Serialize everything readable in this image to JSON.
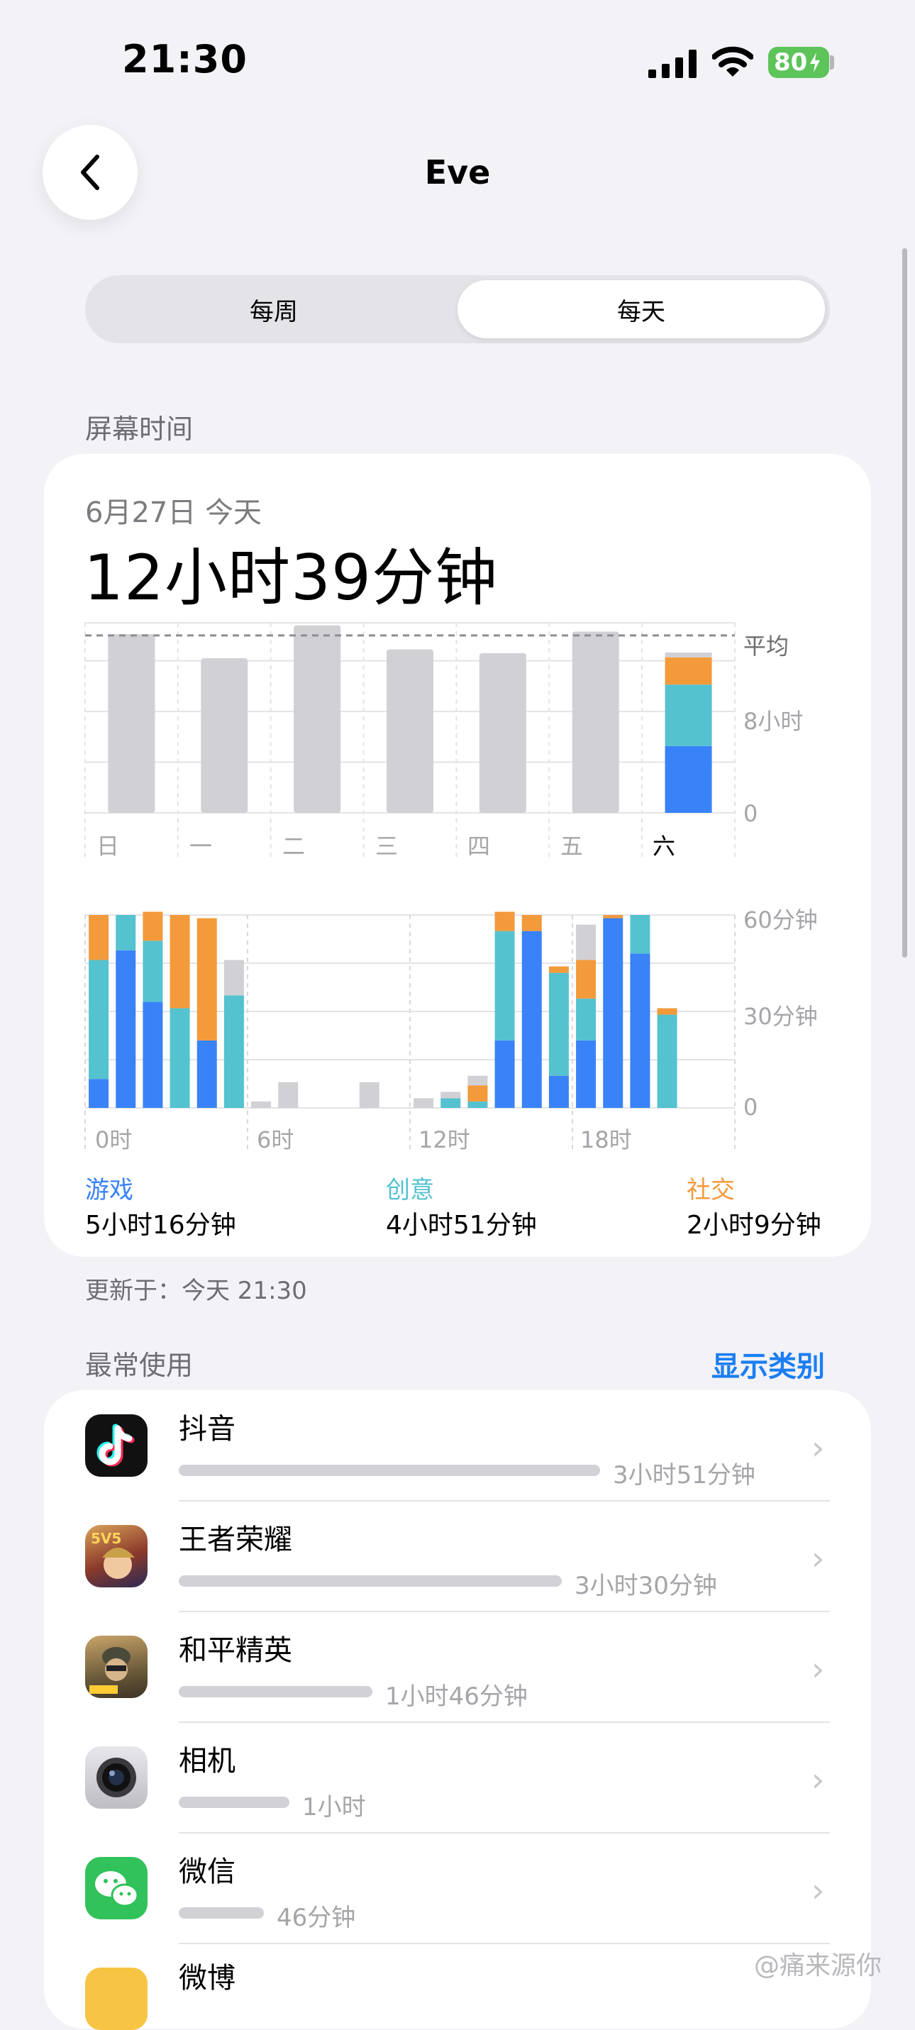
{
  "status": {
    "time": "21:30",
    "battery": "80"
  },
  "nav": {
    "title": "Eve"
  },
  "segmented": {
    "weekly": "每周",
    "daily": "每天",
    "selected": "daily"
  },
  "screen_time": {
    "section_title": "屏幕时间",
    "date": "6月27日 今天",
    "total": "12小时39分钟",
    "updated": "更新于：今天 21:30"
  },
  "colors": {
    "games": "#3a82f7",
    "creative": "#54c2cf",
    "social": "#f39a3b",
    "other": "#d0d0d5",
    "accent": "#1a7ef2"
  },
  "chart_data": [
    {
      "type": "bar",
      "categories": [
        "日",
        "一",
        "二",
        "三",
        "四",
        "五",
        "六"
      ],
      "ylabels": [
        "平均",
        "8小时",
        "0"
      ],
      "series": [
        {
          "values": [
            14.1,
            12.2,
            14.8,
            12.9,
            12.6,
            14.3,
            12.65
          ]
        }
      ],
      "stacks_today": {
        "games": 5.27,
        "creative": 4.85,
        "social": 2.15,
        "other": 0.38
      },
      "average": 14.0,
      "ylim": [
        0,
        15
      ]
    },
    {
      "type": "bar",
      "stacked": true,
      "xlabels": [
        "0时",
        "6时",
        "12时",
        "18时"
      ],
      "ylabels": [
        "60分钟",
        "30分钟",
        "0"
      ],
      "ylim": [
        0,
        60
      ],
      "hours": [
        0,
        1,
        2,
        3,
        4,
        5,
        6,
        7,
        8,
        9,
        10,
        11,
        12,
        13,
        14,
        15,
        16,
        17,
        18,
        19,
        20,
        21,
        22,
        23
      ],
      "series": [
        {
          "name": "游戏",
          "values": [
            9,
            49,
            33,
            0,
            21,
            0,
            0,
            0,
            0,
            0,
            0,
            0,
            0,
            0,
            0,
            21,
            55,
            10,
            21,
            59,
            48,
            0,
            0,
            0
          ]
        },
        {
          "name": "创意",
          "values": [
            37,
            11,
            19,
            31,
            0,
            35,
            0,
            0,
            0,
            0,
            0,
            0,
            0,
            3,
            2,
            34,
            0,
            32,
            13,
            0,
            12,
            29,
            0,
            0
          ]
        },
        {
          "name": "社交",
          "values": [
            14,
            0,
            9,
            29,
            38,
            0,
            0,
            0,
            0,
            0,
            0,
            0,
            0,
            0,
            5,
            6,
            5,
            2,
            12,
            1,
            0,
            2,
            0,
            0
          ]
        },
        {
          "name": "其他",
          "values": [
            0,
            0,
            0,
            0,
            0,
            11,
            2,
            8,
            0,
            0,
            8,
            0,
            3,
            2,
            3,
            0,
            0,
            0,
            11,
            0,
            0,
            0,
            0,
            0
          ]
        }
      ]
    }
  ],
  "legend": [
    {
      "label": "游戏",
      "value": "5小时16分钟",
      "color": "#3a82f7"
    },
    {
      "label": "创意",
      "value": "4小时51分钟",
      "color": "#54c2cf"
    },
    {
      "label": "社交",
      "value": "2小时9分钟",
      "color": "#f39a3b"
    }
  ],
  "most_used": {
    "title": "最常使用",
    "show_categories": "显示类别",
    "apps": [
      {
        "name": "抖音",
        "time": "3小时51分钟",
        "minutes": 231,
        "icon": "douyin-icon"
      },
      {
        "name": "王者荣耀",
        "time": "3小时30分钟",
        "minutes": 210,
        "icon": "honor-of-kings-icon"
      },
      {
        "name": "和平精英",
        "time": "1小时46分钟",
        "minutes": 106,
        "icon": "peacekeeper-elite-icon"
      },
      {
        "name": "相机",
        "time": "1小时",
        "minutes": 60,
        "icon": "camera-icon"
      },
      {
        "name": "微信",
        "time": "46分钟",
        "minutes": 46,
        "icon": "wechat-icon"
      },
      {
        "name": "微博",
        "time": "",
        "minutes": 0,
        "icon": "weibo-icon"
      }
    ]
  },
  "watermark": "@痛来源你"
}
